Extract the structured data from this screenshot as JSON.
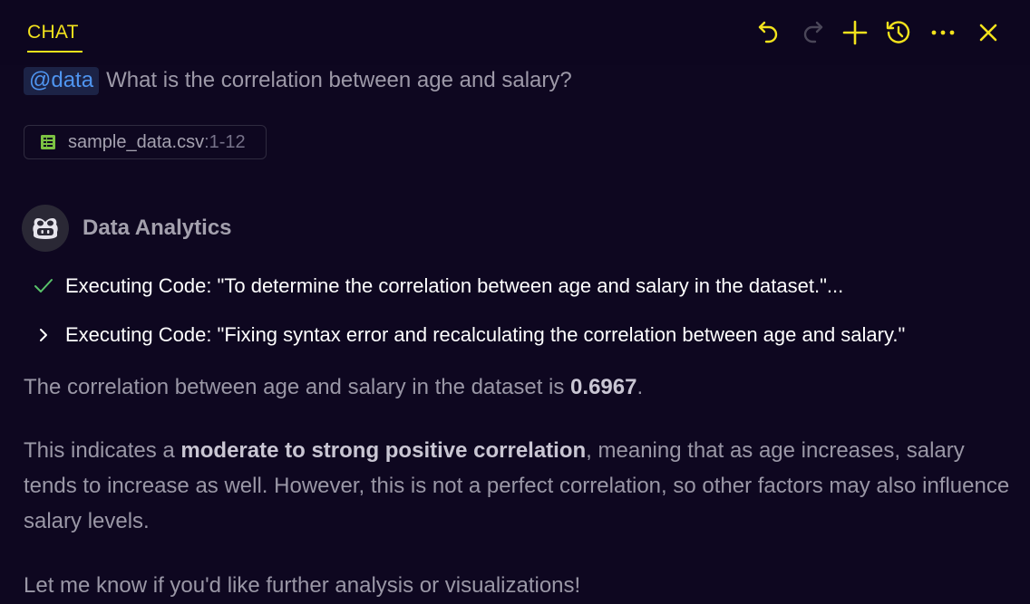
{
  "header": {
    "tab_label": "CHAT",
    "accent_color": "#f2e21c",
    "actions": [
      {
        "name": "undo-icon"
      },
      {
        "name": "redo-icon"
      },
      {
        "name": "plus-icon"
      },
      {
        "name": "history-icon"
      },
      {
        "name": "more-icon"
      },
      {
        "name": "close-icon"
      }
    ]
  },
  "user_message": {
    "mention": "@data",
    "text": "What is the correlation between age and salary?",
    "attachment": {
      "icon": "spreadsheet-icon",
      "file_name": "sample_data.csv",
      "range": ":1-12"
    }
  },
  "agent": {
    "name": "Data Analytics",
    "avatar_icon": "copilot-icon",
    "steps": [
      {
        "status": "done",
        "icon": "check-icon",
        "text": "Executing Code: \"To determine the correlation between age and salary in the dataset.\"..."
      },
      {
        "status": "collapsed",
        "icon": "chevron-right-icon",
        "text": "Executing Code: \"Fixing syntax error and recalculating the correlation between age and salary.\""
      }
    ]
  },
  "response": {
    "p1_prefix": "The correlation between age and salary in the dataset is ",
    "p1_value": "0.6967",
    "p1_suffix": ".",
    "p2_prefix": "This indicates a ",
    "p2_bold": "moderate to strong positive correlation",
    "p2_suffix": ", meaning that as age increases, salary tends to increase as well. However, this is not a perfect correlation, so other factors may also influence salary levels.",
    "p3": "Let me know if you'd like further analysis or visualizations!"
  }
}
